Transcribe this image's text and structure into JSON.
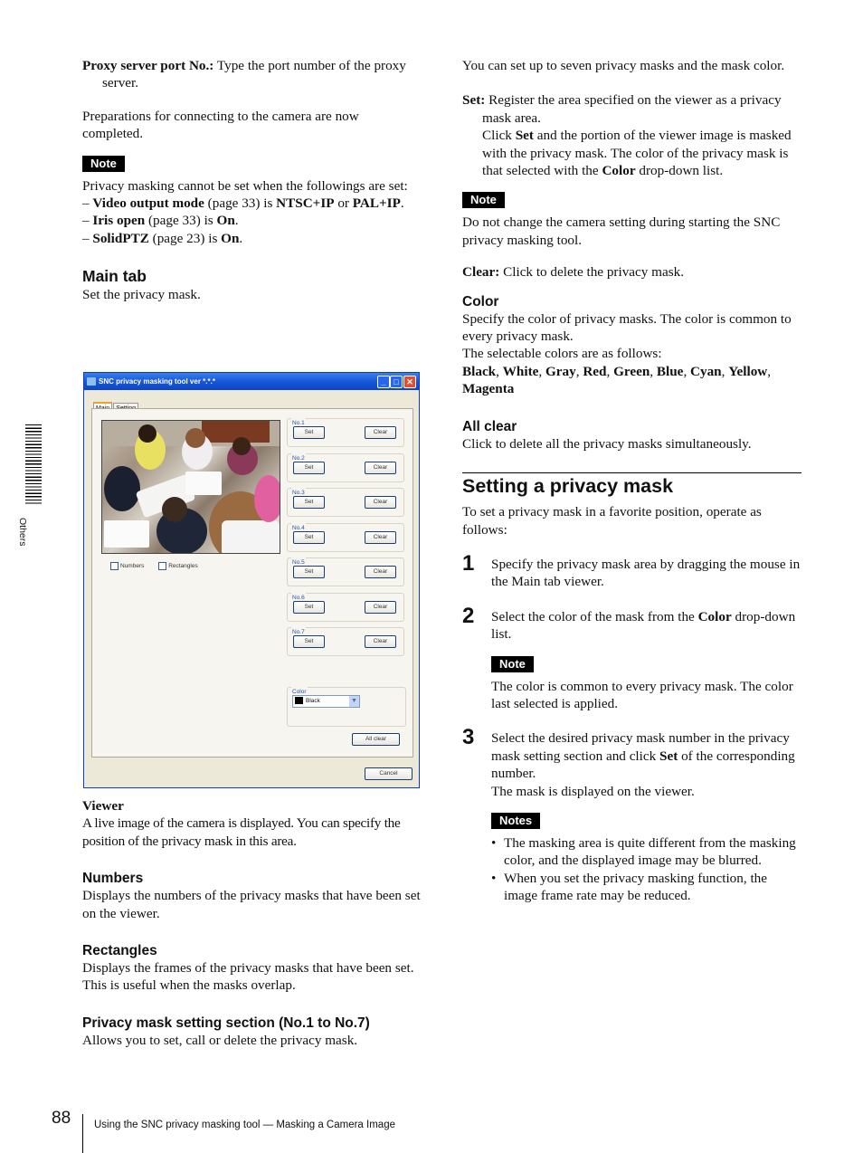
{
  "left": {
    "proxy_term": "Proxy server port No.:",
    "proxy_desc": " Type the port number of the proxy server.",
    "prep_text": "Preparations for connecting to the camera are now completed.",
    "note_label": "Note",
    "note_intro": "Privacy masking cannot be set when the followings are set:",
    "note_items": [
      {
        "b1": "Video output mode",
        "t1": " (page 33) is ",
        "b2": "NTSC+IP",
        "t2": " or ",
        "b3": "PAL+IP",
        "t3": "."
      },
      {
        "b1": "Iris open",
        "t1": " (page 33) is ",
        "b2": "On",
        "t2": "."
      },
      {
        "b1": "SolidPTZ",
        "t1": " (page 23) is ",
        "b2": "On",
        "t2": "."
      }
    ],
    "main_tab_heading": "Main tab",
    "main_tab_desc": "Set the privacy mask.",
    "viewer_heading": "Viewer",
    "viewer_desc": "A live image of the camera is displayed.  You can specify the position of the privacy mask in this area.",
    "numbers_heading": "Numbers",
    "numbers_desc": "Displays the numbers of the privacy masks that have been set on the viewer.",
    "rectangles_heading": "Rectangles",
    "rectangles_desc": "Displays the frames of the privacy masks that have been set. This is useful when the masks overlap.",
    "section_heading": "Privacy mask setting section (No.1 to No.7)",
    "section_desc": "Allows you to set, call or delete the privacy mask."
  },
  "window": {
    "title": "SNC privacy masking tool  ver *.*.*",
    "tabs": [
      "Main",
      "Setting"
    ],
    "active_tab": "Main",
    "checkboxes": [
      {
        "label": "Numbers",
        "checked": false
      },
      {
        "label": "Rectangles",
        "checked": false
      }
    ],
    "mask_groups": [
      {
        "label": "No.1",
        "set": "Set",
        "clear": "Clear"
      },
      {
        "label": "No.2",
        "set": "Set",
        "clear": "Clear"
      },
      {
        "label": "No.3",
        "set": "Set",
        "clear": "Clear"
      },
      {
        "label": "No.4",
        "set": "Set",
        "clear": "Clear"
      },
      {
        "label": "No.5",
        "set": "Set",
        "clear": "Clear"
      },
      {
        "label": "No.6",
        "set": "Set",
        "clear": "Clear"
      },
      {
        "label": "No.7",
        "set": "Set",
        "clear": "Clear"
      }
    ],
    "color_label": "Color",
    "color_value": "Black",
    "color_swatch": "#000000",
    "all_clear_label": "All clear",
    "cancel_label": "Cancel",
    "title_bar_color": "#1857d8"
  },
  "right": {
    "intro": "You can set up to seven privacy masks and the mask color.",
    "set_term": "Set:",
    "set_desc1": " Register the area specified on the viewer as a privacy mask area.",
    "set_desc2a": "Click ",
    "set_desc2b": "Set",
    "set_desc2c": " and the portion of the viewer image is masked with the privacy mask. The color of the privacy mask is that selected with the ",
    "set_desc2d": "Color",
    "set_desc2e": " drop-down list.",
    "note_label": "Note",
    "note_text": "Do not change the camera setting during starting the SNC privacy masking tool.",
    "clear_term": "Clear:",
    "clear_desc": " Click to delete the privacy mask.",
    "color_heading": "Color",
    "color_desc1": "Specify the color of privacy masks.  The color is common to every privacy mask.",
    "color_desc2": "The selectable colors are as follows:",
    "colors": [
      "Black",
      "White",
      "Gray",
      "Red",
      "Green",
      "Blue",
      "Cyan",
      "Yellow",
      "Magenta"
    ],
    "allclear_heading": "All clear",
    "allclear_desc": "Click to delete all the privacy masks simultaneously.",
    "setting_heading": "Setting a privacy mask",
    "setting_intro": "To set a privacy mask in a favorite position, operate as follows:",
    "steps": [
      {
        "num": "1",
        "text": "Specify the privacy mask area by dragging the mouse in the Main tab viewer."
      },
      {
        "num": "2",
        "text_a": "Select the color of the mask from the ",
        "text_b": "Color",
        "text_c": " drop-down list."
      },
      {
        "num": "3",
        "text_a": "Select the desired privacy mask number in the privacy mask setting section and click ",
        "text_b": "Set",
        "text_c": " of the corresponding number.",
        "text_d": "The mask is displayed on the viewer."
      }
    ],
    "step2_note_label": "Note",
    "step2_note": "The color is common to every privacy mask. The color last selected is applied.",
    "notes_label": "Notes",
    "notes": [
      "The masking area is quite different from the masking color, and the displayed image may be blurred.",
      "When you set the privacy masking function, the image frame rate may be reduced."
    ]
  },
  "side_tab": {
    "label": "Others"
  },
  "footer": {
    "page_number": "88",
    "text": "Using the SNC privacy masking tool — Masking a Camera Image"
  }
}
